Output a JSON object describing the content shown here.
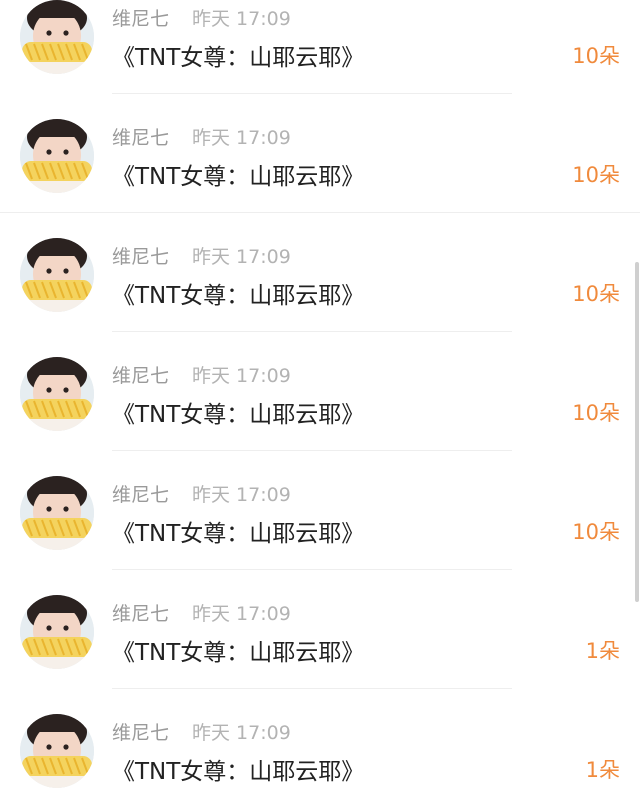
{
  "messages": [
    {
      "name": "维尼七",
      "time": "昨天 17:09",
      "title": "《TNT女尊：山耶云耶》",
      "count": "10朵"
    },
    {
      "name": "维尼七",
      "time": "昨天 17:09",
      "title": "《TNT女尊：山耶云耶》",
      "count": "10朵"
    },
    {
      "name": "维尼七",
      "time": "昨天 17:09",
      "title": "《TNT女尊：山耶云耶》",
      "count": "10朵"
    },
    {
      "name": "维尼七",
      "time": "昨天 17:09",
      "title": "《TNT女尊：山耶云耶》",
      "count": "10朵"
    },
    {
      "name": "维尼七",
      "time": "昨天 17:09",
      "title": "《TNT女尊：山耶云耶》",
      "count": "10朵"
    },
    {
      "name": "维尼七",
      "time": "昨天 17:09",
      "title": "《TNT女尊：山耶云耶》",
      "count": "1朵"
    },
    {
      "name": "维尼七",
      "time": "昨天 17:09",
      "title": "《TNT女尊：山耶云耶》",
      "count": "1朵"
    }
  ],
  "colors": {
    "count_accent": "#f08a3c",
    "name_text": "#9a9a9a",
    "time_text": "#b3b3b3",
    "title_text": "#222222"
  }
}
